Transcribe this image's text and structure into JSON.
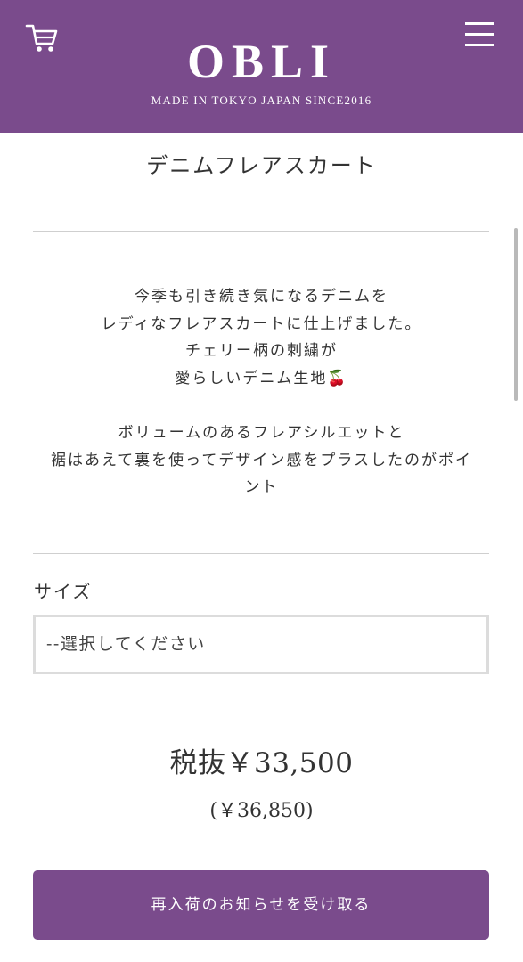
{
  "header": {
    "logo": "OBLI",
    "tagline": "MADE IN TOKYO JAPAN SINCE2016",
    "background_color": "#7a4b8c",
    "cart_icon": "cart-icon",
    "menu_icon": "hamburger-menu-icon"
  },
  "product": {
    "title": "デニムフレアスカート",
    "description": {
      "lines1": [
        "今季も引き続き気になるデニムを",
        "レディなフレアスカートに仕上げました。",
        "チェリー柄の刺繍が",
        "愛らしいデニム生地"
      ],
      "emoji": "🍒",
      "lines2": [
        "ボリュームのあるフレアシルエットと",
        "裾はあえて裏を使ってデザイン感をプラスしたのがポイ",
        "ント"
      ]
    }
  },
  "options": {
    "size_label": "サイズ",
    "size_selected": "--選択してください"
  },
  "price": {
    "excl_tax": "税抜￥33,500",
    "incl_tax": "(￥36,850)"
  },
  "actions": {
    "notify_label": "再入荷のお知らせを受け取る",
    "button_color": "#7a4b8c"
  }
}
